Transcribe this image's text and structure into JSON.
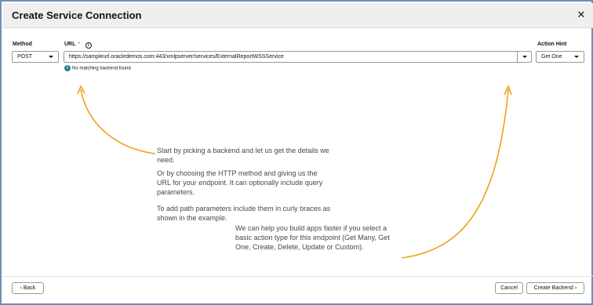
{
  "dialog": {
    "title": "Create Service Connection",
    "close_icon": "close-icon"
  },
  "form": {
    "method": {
      "label": "Method",
      "value": "POST"
    },
    "url": {
      "label": "URL",
      "required_mark": "*",
      "info_icon": "info-icon",
      "value": "https://sampleurl.oracledemos.com:443/xmlpserver/services/ExternalReportWSSService",
      "hint_icon": "i",
      "hint": "No matching backend found"
    },
    "action_hint": {
      "label": "Action Hint",
      "value": "Get One"
    }
  },
  "help": {
    "p1": "Start by picking a backend and let us get the details we",
    "p1b": "need.",
    "p2": "Or by choosing the HTTP method and giving us the",
    "p2b": "URL for your endpoint. It can optionally include query",
    "p2c": "parameters.",
    "p3": "To add path parameters include them in curly braces as",
    "p3b": "shown in the example.",
    "p4": "We can help you build apps faster if you select a",
    "p4b": "basic action type for this endpoint (Get Many, Get",
    "p4c": "One, Create, Delete, Update or Custom)."
  },
  "footer": {
    "back_label": "Back",
    "cancel_label": "Cancel",
    "create_label": "Create Backend"
  },
  "colors": {
    "accent_arrow": "#f0a21b",
    "info_blue": "#227e9e",
    "required": "#c74634"
  }
}
